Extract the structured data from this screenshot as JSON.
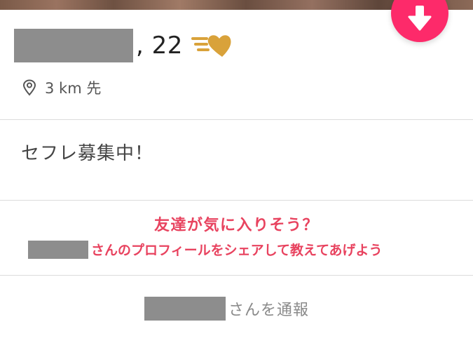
{
  "profile": {
    "name_redacted": "",
    "age": ", 22",
    "distance": "3 km 先",
    "bio": "セフレ募集中！"
  },
  "share": {
    "title": "友達が気に入りそう？",
    "subtitle": "さんのプロフィールをシェアして教えてあげよう"
  },
  "report": {
    "label": "さんを通報"
  },
  "colors": {
    "accent": "#e8435f",
    "rewind_button": "#fd2a6a",
    "heart": "#d9a23a"
  },
  "icons": {
    "rewind": "arrow-down-icon",
    "super_like": "speed-heart-icon",
    "location": "location-pin-icon"
  }
}
